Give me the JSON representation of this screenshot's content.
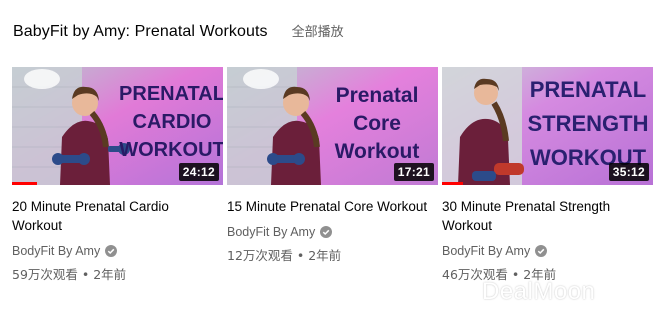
{
  "shelf": {
    "title": "BabyFit by Amy: Prenatal Workouts",
    "play_all": "全部播放"
  },
  "videos": [
    {
      "title": "20 Minute Prenatal Cardio Workout",
      "channel": "BodyFit By Amy",
      "meta": "59万次观看 • 2年前",
      "duration": "24:12",
      "thumb_text": [
        "PRENATAL",
        "CARDIO",
        "WORKOUT"
      ],
      "watch_progress": 0.12,
      "colors": {
        "bg": "#c774c8",
        "text": "#2a1a66"
      }
    },
    {
      "title": "15 Minute Prenatal Core Workout",
      "channel": "BodyFit By Amy",
      "meta": "12万次观看 • 2年前",
      "duration": "17:21",
      "thumb_text": [
        "Prenatal",
        "Core",
        "Workout"
      ],
      "watch_progress": 0,
      "colors": {
        "bg": "#d07ad2",
        "text": "#2a1a66"
      }
    },
    {
      "title": "30 Minute Prenatal Strength Workout",
      "channel": "BodyFit By Amy",
      "meta": "46万次观看 • 2年前",
      "duration": "35:12",
      "thumb_text": [
        "PRENATAL",
        "STRENGTH",
        "WORKOUT"
      ],
      "watch_progress": 0.1,
      "colors": {
        "bg": "#c778d6",
        "text": "#2a2070"
      }
    }
  ],
  "watermark": "DealMoon",
  "icons": {
    "verified": "verified-check-icon"
  },
  "colors": {
    "progress": "#ff0000",
    "meta_text": "#606060",
    "title_text": "#030303"
  }
}
